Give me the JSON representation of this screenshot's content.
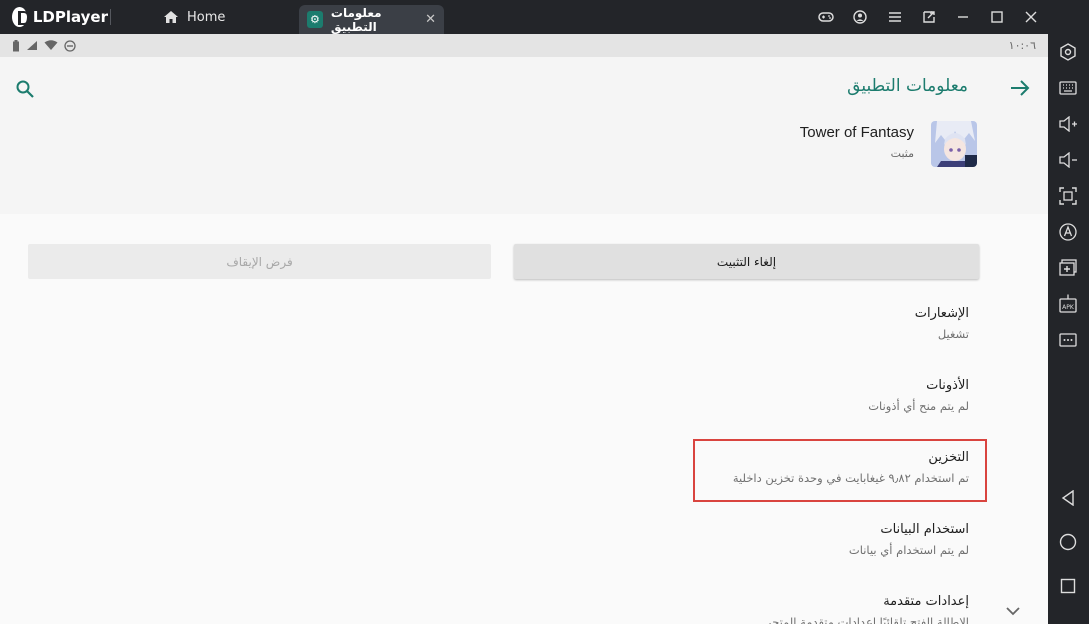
{
  "titlebar": {
    "app_name": "LDPlayer",
    "home_tab_label": "Home",
    "active_tab_label": "معلومات التطبيق",
    "active_tab_close": "✕"
  },
  "statusbar": {
    "time": "١٠:٠٦"
  },
  "appbar": {
    "title": "معلومات التطبيق"
  },
  "app": {
    "name": "Tower of Fantasy",
    "status": "مثبت"
  },
  "buttons": {
    "uninstall": "إلغاء التثبيت",
    "force_stop": "فرض الإيقاف"
  },
  "items": [
    {
      "title": "الإشعارات",
      "subtitle": "تشغيل"
    },
    {
      "title": "الأذونات",
      "subtitle": "لم يتم منح أي أذونات"
    },
    {
      "title": "التخزين",
      "subtitle": "تم استخدام ٩٫٨٢ غيغابايت في وحدة تخزين داخلية"
    },
    {
      "title": "استخدام البيانات",
      "subtitle": "لم يتم استخدام أي بيانات"
    },
    {
      "title": "إعدادات متقدمة",
      "subtitle": "الإطالة الفتح تلقائيًا إعدادات متقدمة المتجر"
    }
  ],
  "colors": {
    "accent": "#1c7c6e",
    "highlight": "#d9443f",
    "titlebar": "#232529"
  },
  "icons": {
    "titlebar": [
      "gamepad-icon",
      "account-icon",
      "menu-icon",
      "popout-icon",
      "minimize-icon",
      "maximize-icon",
      "close-icon"
    ],
    "sidebar": [
      "settings-icon",
      "keyboard-icon",
      "volume-up-icon",
      "volume-down-icon",
      "screenshot-icon",
      "auto-click-icon",
      "add-instance-icon",
      "apk-install-icon",
      "more-icon",
      "back-icon",
      "home-icon",
      "recents-icon"
    ]
  }
}
